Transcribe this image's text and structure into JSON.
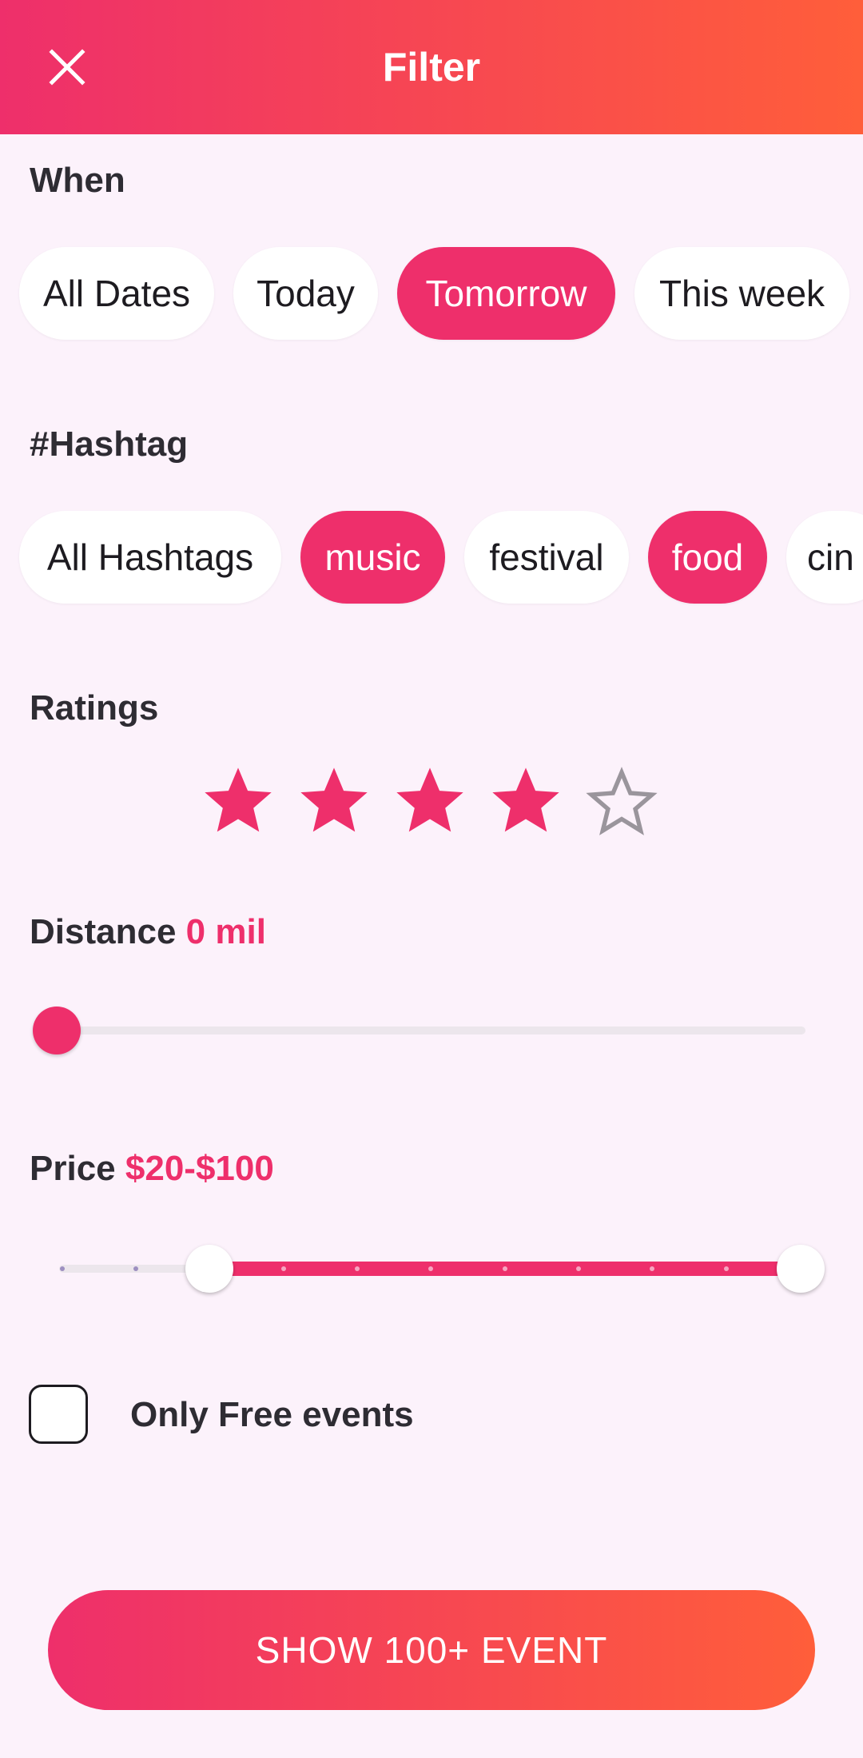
{
  "header": {
    "title": "Filter",
    "close_icon": "close-icon"
  },
  "when": {
    "title": "When",
    "chips": [
      {
        "label": "All Dates",
        "selected": false
      },
      {
        "label": "Today",
        "selected": false
      },
      {
        "label": "Tomorrow",
        "selected": true
      },
      {
        "label": "This week",
        "selected": false
      }
    ]
  },
  "hashtag": {
    "title": "#Hashtag",
    "chips": [
      {
        "label": "All Hashtags",
        "selected": false
      },
      {
        "label": "music",
        "selected": true
      },
      {
        "label": "festival",
        "selected": false
      },
      {
        "label": "food",
        "selected": true
      },
      {
        "label": "cin",
        "selected": false
      }
    ]
  },
  "ratings": {
    "title": "Ratings",
    "value": 4,
    "max": 5
  },
  "distance": {
    "label": "Distance",
    "value_text": "0 mil",
    "value": 0
  },
  "price": {
    "label": "Price",
    "value_text": "$20-$100",
    "range": [
      20,
      100
    ],
    "min": 0,
    "max": 100,
    "step": 10
  },
  "free_events": {
    "label": "Only Free events",
    "checked": false
  },
  "cta": {
    "label": "SHOW 100+ EVENT"
  },
  "colors": {
    "accent": "#ee2f6b",
    "gradient_end": "#ff5e3a",
    "background": "#fcf2fb"
  }
}
